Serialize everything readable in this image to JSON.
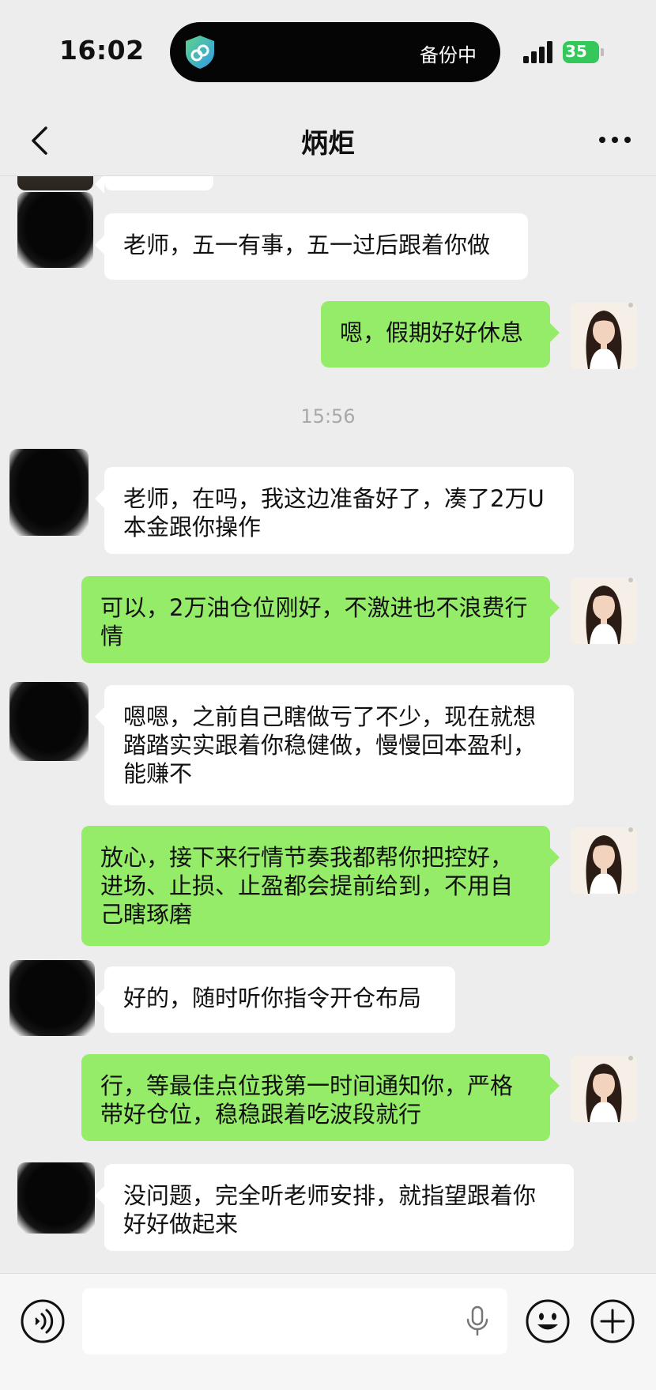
{
  "status_bar": {
    "time": "16:02",
    "island_text": "备份中",
    "battery": "35"
  },
  "nav": {
    "title": "炳炬",
    "back_icon": "chevron-left-icon",
    "more_icon": "more-dots-icon"
  },
  "messages": [
    {
      "side": "in",
      "text": "老师，五一有事，五一过后跟着你做"
    },
    {
      "side": "out",
      "text": "嗯，假期好好休息"
    },
    {
      "side": "time",
      "text": "15:56"
    },
    {
      "side": "in",
      "text": "老师，在吗，我这边准备好了，凑了2万U本金跟你操作"
    },
    {
      "side": "out",
      "text": "可以，2万油仓位刚好，不激进也不浪费行情"
    },
    {
      "side": "in",
      "text": "嗯嗯，之前自己瞎做亏了不少，现在就想踏踏实实跟着你稳健做，慢慢回本盈利，能赚不"
    },
    {
      "side": "out",
      "text": "放心，接下来行情节奏我都帮你把控好，进场、止损、止盈都会提前给到，不用自己瞎琢磨"
    },
    {
      "side": "in",
      "text": "好的，随时听你指令开仓布局"
    },
    {
      "side": "out",
      "text": "行，等最佳点位我第一时间通知你，严格带好仓位，稳稳跟着吃波段就行"
    },
    {
      "side": "in",
      "text": "没问题，完全听老师安排，就指望跟着你好好做起来"
    }
  ],
  "input_bar": {
    "placeholder": "",
    "icons": [
      "voice-icon",
      "mic-icon",
      "emoji-icon",
      "plus-icon"
    ]
  },
  "colors": {
    "background": "#ededed",
    "outgoing_bubble": "#95ec69",
    "incoming_bubble": "#ffffff",
    "battery": "#34c759"
  }
}
